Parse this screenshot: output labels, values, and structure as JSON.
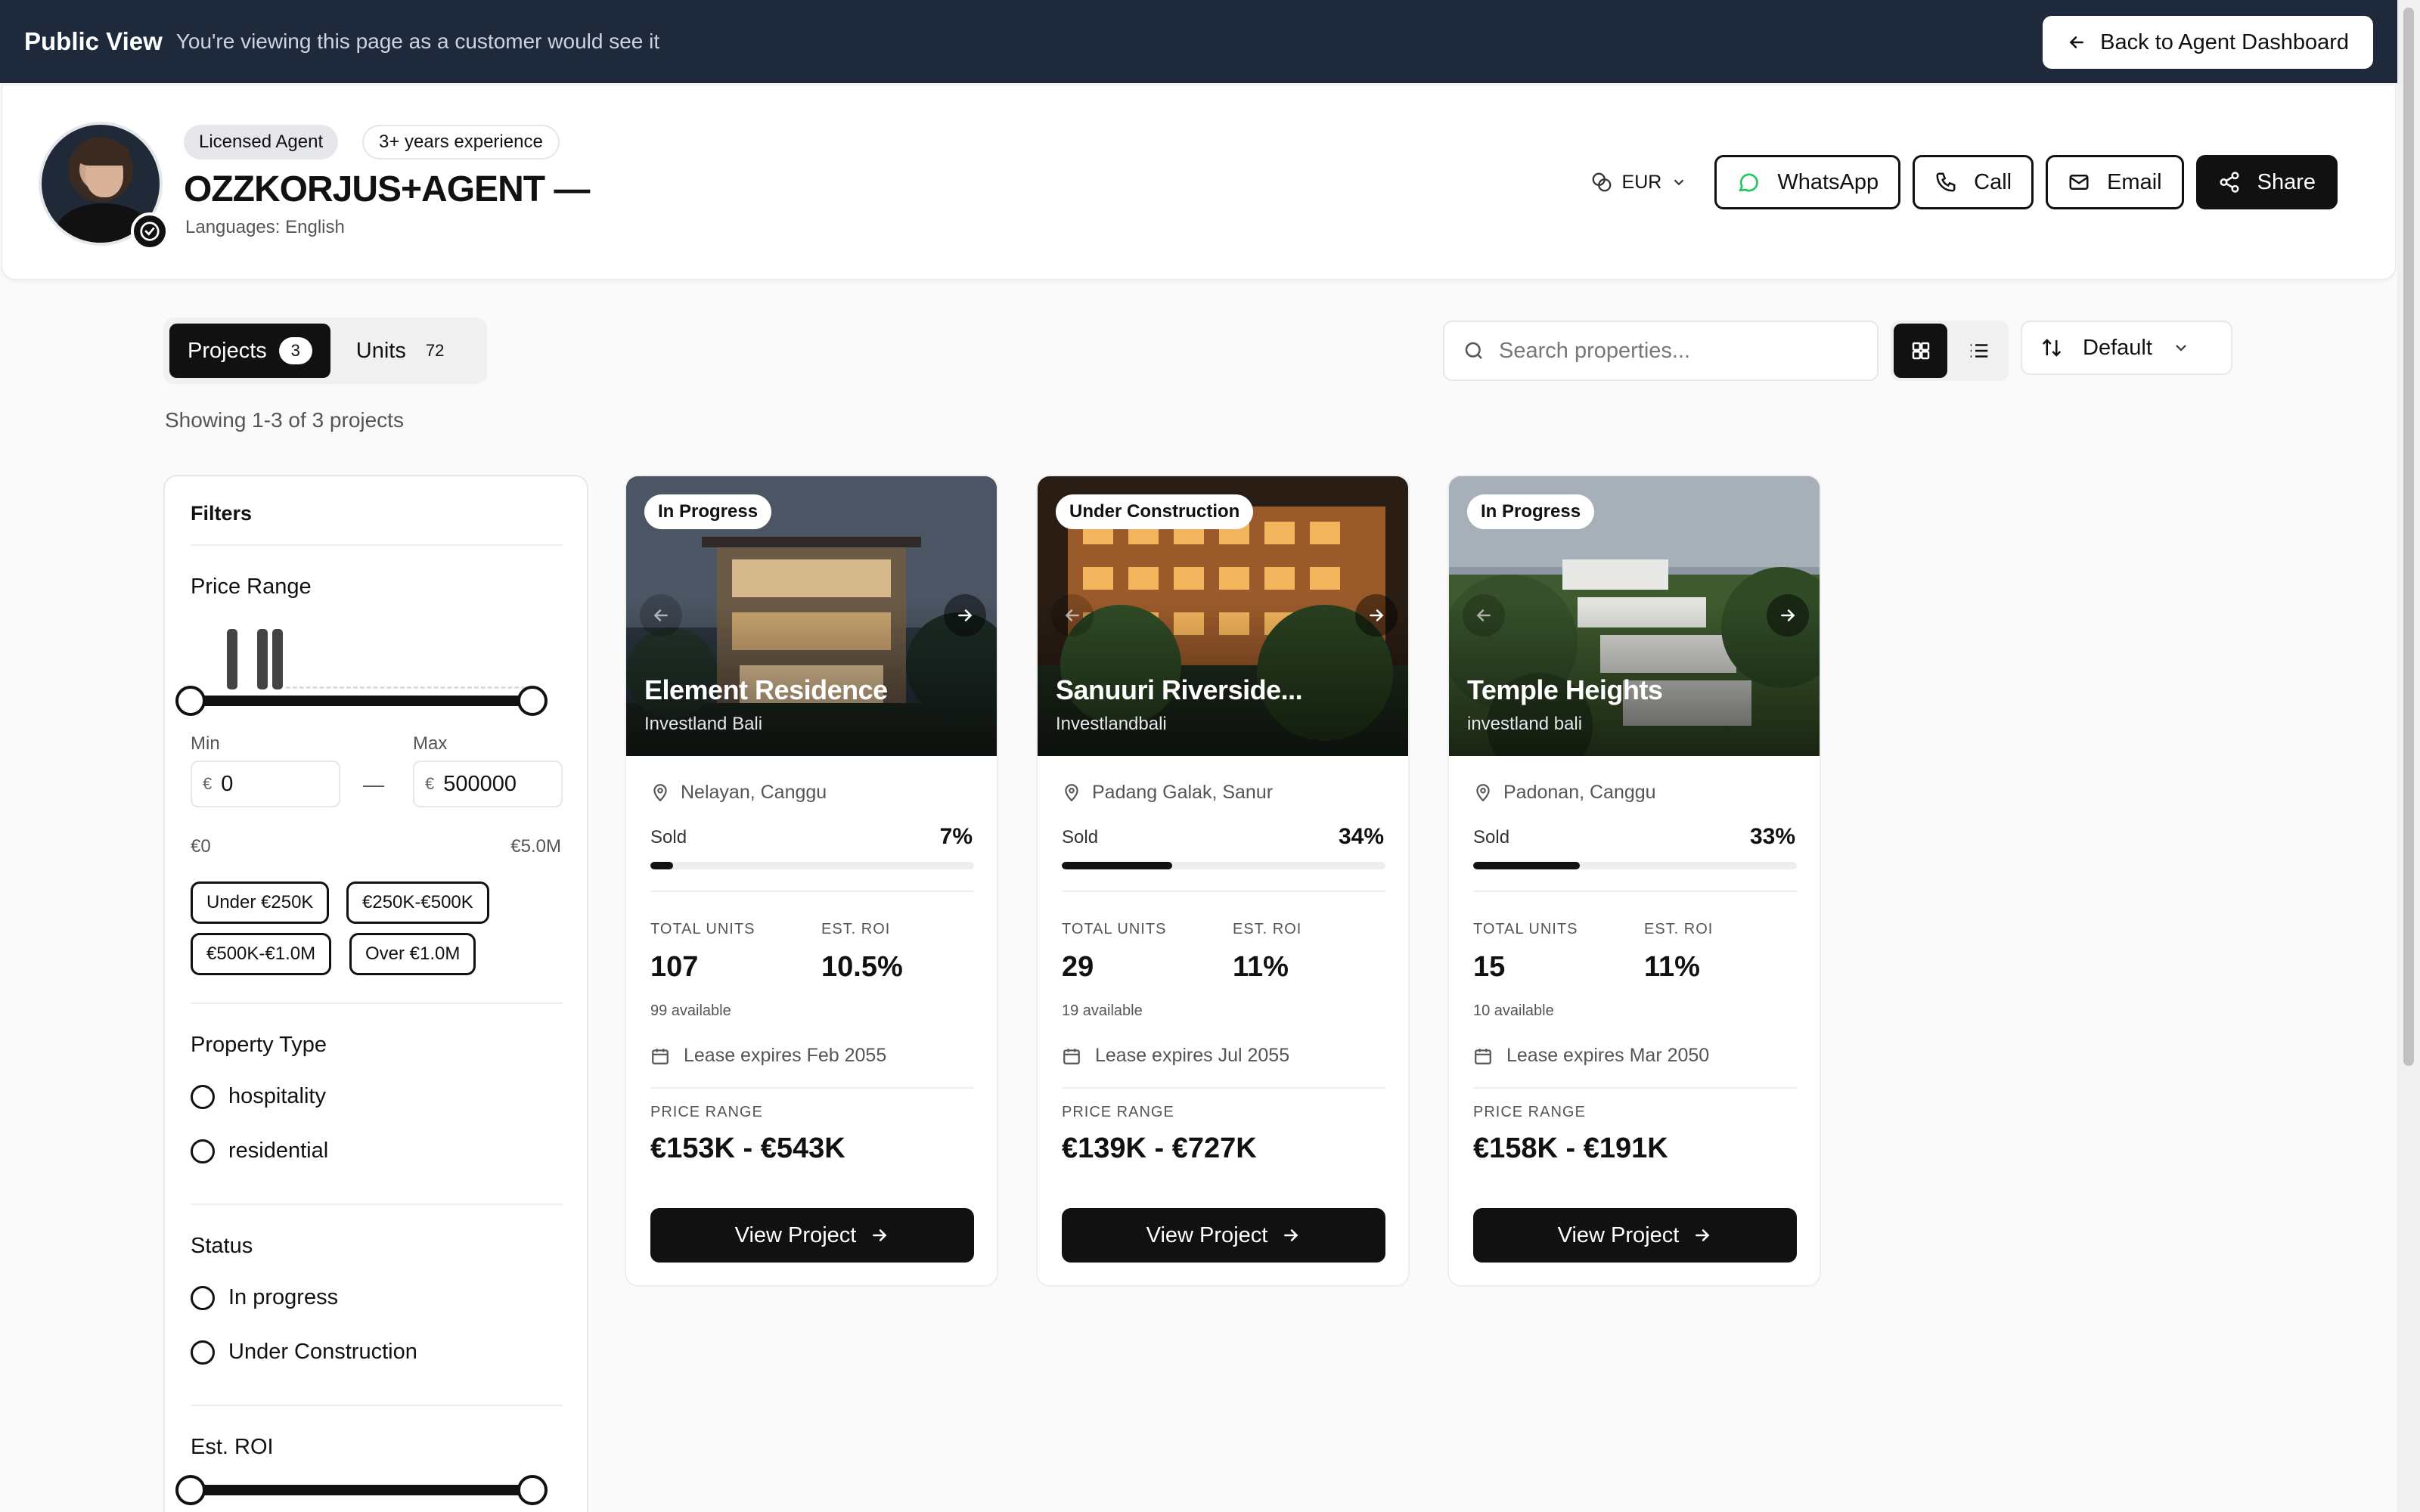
{
  "topbar": {
    "title": "Public View",
    "subtitle": "You're viewing this page as a customer would see it",
    "back_label": "Back to Agent Dashboard"
  },
  "agent": {
    "badge_licensed": "Licensed Agent",
    "badge_experience": "3+ years experience",
    "name": "OZZKORJUS+AGENT —",
    "languages": "Languages: English",
    "currency": "EUR",
    "whatsapp": "WhatsApp",
    "call": "Call",
    "email": "Email",
    "share": "Share"
  },
  "tabs": [
    {
      "label": "Projects",
      "count": "3"
    },
    {
      "label": "Units",
      "count": "72"
    }
  ],
  "showing": "Showing 1-3 of 3 projects",
  "search": {
    "placeholder": "Search properties..."
  },
  "sort": {
    "label": "Default"
  },
  "filters": {
    "title": "Filters",
    "price_range": "Price Range",
    "min_label": "Min",
    "max_label": "Max",
    "currency_symbol": "€",
    "min_value": "0",
    "max_value": "500000",
    "range_min": "€0",
    "range_max": "€5.0M",
    "pills": [
      "Under €250K",
      "€250K-€500K",
      "€500K-€1.0M",
      "Over €1.0M"
    ],
    "property_type": "Property Type",
    "types": [
      "hospitality",
      "residential"
    ],
    "status": "Status",
    "statuses": [
      "In progress",
      "Under Construction"
    ],
    "roi": "Est. ROI"
  },
  "labels": {
    "sold": "Sold",
    "total_units": "TOTAL UNITS",
    "est_roi": "EST. ROI",
    "price_range": "PRICE RANGE",
    "view_project": "View Project"
  },
  "projects": [
    {
      "status": "In Progress",
      "name": "Element Residence",
      "developer": "Investland Bali",
      "location": "Nelayan, Canggu",
      "sold_pct": 7,
      "sold_label": "7%",
      "total_units": "107",
      "available": "99 available",
      "roi": "10.5%",
      "lease": "Lease expires Feb 2055",
      "price": "€153K - €543K"
    },
    {
      "status": "Under Construction",
      "name": "Sanuuri Riverside...",
      "developer": "Investlandbali",
      "location": "Padang Galak, Sanur",
      "sold_pct": 34,
      "sold_label": "34%",
      "total_units": "29",
      "available": "19 available",
      "roi": "11%",
      "lease": "Lease expires Jul 2055",
      "price": "€139K - €727K"
    },
    {
      "status": "In Progress",
      "name": "Temple Heights",
      "developer": "investland bali",
      "location": "Padonan, Canggu",
      "sold_pct": 33,
      "sold_label": "33%",
      "total_units": "15",
      "available": "10 available",
      "roi": "11%",
      "lease": "Lease expires Mar 2050",
      "price": "€158K - €191K"
    }
  ]
}
